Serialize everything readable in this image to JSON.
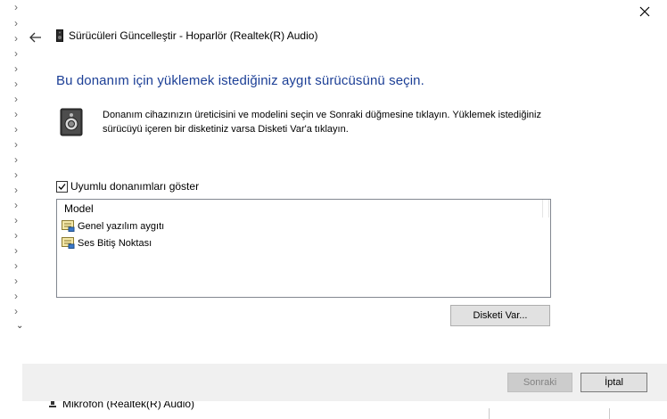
{
  "window": {
    "title": "Sürücüleri Güncelleştir - Hoparlör (Realtek(R) Audio)"
  },
  "heading": "Bu donanım için yüklemek istediğiniz aygıt sürücüsünü seçin.",
  "info_text": "Donanım cihazınızın üreticisini ve modelini seçin ve Sonraki düğmesine tıklayın. Yüklemek istediğiniz sürücüyü içeren bir disketiniz varsa Disketi Var'a tıklayın.",
  "compat_checkbox": {
    "label": "Uyumlu donanımları göster",
    "checked": true
  },
  "model_list": {
    "header": "Model",
    "items": [
      {
        "label": "Genel yazılım aygıtı",
        "icon": "driver-icon"
      },
      {
        "label": "Ses Bitiş Noktası",
        "icon": "driver-icon"
      }
    ]
  },
  "buttons": {
    "have_disk": "Disketi Var...",
    "next": "Sonraki",
    "cancel": "İptal"
  },
  "background": {
    "bottom_item": "Mikrofon (Realtek(R) Audio)"
  },
  "colors": {
    "heading": "#1c3f96",
    "footer_bg": "#f0f0f0",
    "disabled_text": "#838383"
  }
}
